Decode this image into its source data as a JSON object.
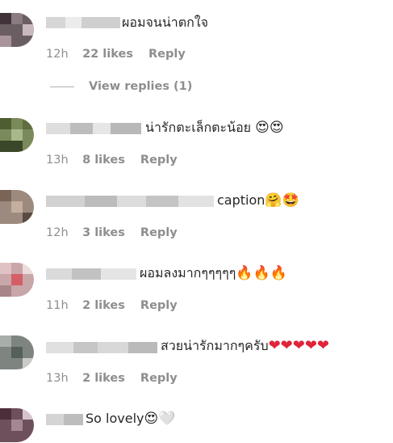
{
  "comments": [
    {
      "text": "ผอมจนน่าตกใจ",
      "emojis": "",
      "time": "12h",
      "likes": "22 likes",
      "reply": "Reply"
    },
    {
      "text": "น่ารักตะเล็กตะน้อย",
      "emojis": "😍😍",
      "time": "13h",
      "likes": "8 likes",
      "reply": "Reply"
    },
    {
      "text": "caption",
      "emojis": "🤗🤩",
      "time": "12h",
      "likes": "3 likes",
      "reply": "Reply"
    },
    {
      "text": "ผอมลงมากๆๆๆๆๆ",
      "emojis": "🔥🔥🔥",
      "time": "11h",
      "likes": "2 likes",
      "reply": "Reply"
    },
    {
      "text": "สวยน่ารักมากๆครับ",
      "emojis": "❤❤❤❤❤",
      "time": "13h",
      "likes": "2 likes",
      "reply": "Reply"
    },
    {
      "text": "So lovely",
      "emojis": "😍🤍",
      "time": "",
      "likes": "",
      "reply": ""
    }
  ],
  "view_replies": "View replies (1)"
}
